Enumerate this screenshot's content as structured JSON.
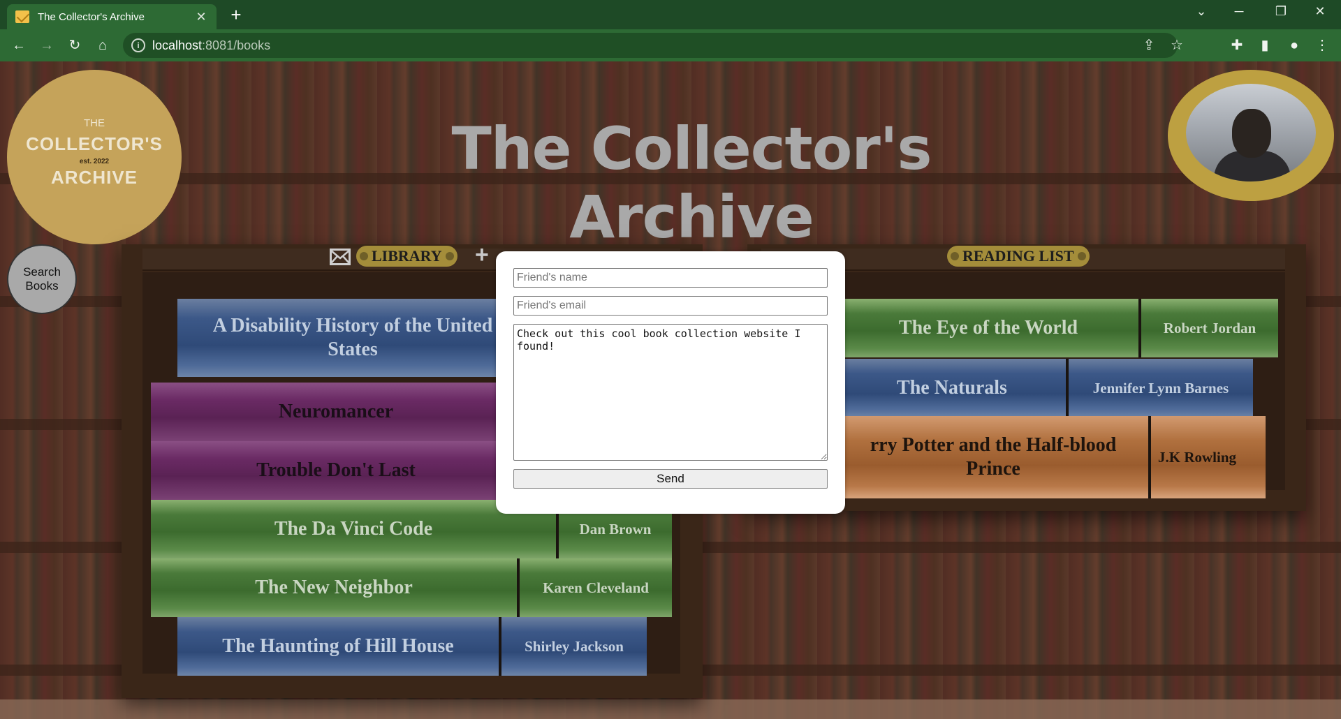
{
  "browser": {
    "tab_title": "The Collector's Archive",
    "tab_close": "✕",
    "new_tab": "+",
    "url_host": "localhost",
    "url_rest": ":8081/books",
    "info_glyph": "i",
    "icons": [
      "back-icon",
      "forward-icon",
      "reload-icon",
      "home-icon",
      "share-icon",
      "star-icon",
      "extensions-icon",
      "sidepanel-icon",
      "profile-icon",
      "menu-icon"
    ]
  },
  "site": {
    "logo": {
      "line1": "THE",
      "line2": "COLLECTOR'S",
      "line3": "est. 2022",
      "line4": "ARCHIVE"
    },
    "title": "The Collector's Archive",
    "search_books_label": "Search Books"
  },
  "library": {
    "label": "LIBRARY",
    "books": [
      {
        "title": "A Disability History of the United States",
        "author": "",
        "color": "blue"
      },
      {
        "title": "Neuromancer",
        "author": "",
        "color": "purple"
      },
      {
        "title": "Trouble Don't Last",
        "author": "",
        "color": "purple"
      },
      {
        "title": "The Da Vinci Code",
        "author": "Dan Brown",
        "color": "green"
      },
      {
        "title": "The New Neighbor",
        "author": "Karen Cleveland",
        "color": "green"
      },
      {
        "title": "The Haunting of Hill House",
        "author": "Shirley Jackson",
        "color": "blue"
      }
    ]
  },
  "reading_list": {
    "label": "READING LIST",
    "books": [
      {
        "title": "The Eye of the World",
        "author": "Robert Jordan",
        "color": "green"
      },
      {
        "title": "The Naturals",
        "author": "Jennifer Lynn Barnes",
        "color": "blue"
      },
      {
        "title": "rry Potter and the Half-blood Prince",
        "author": "J.K Rowling",
        "color": "orange"
      }
    ]
  },
  "share_modal": {
    "name_placeholder": "Friend's name",
    "email_placeholder": "Friend's email",
    "message": "Check out this cool book collection website I found!",
    "send_label": "Send"
  },
  "colors": {
    "chrome_dark": "#1e4a26",
    "chrome": "#2d6a34",
    "gold": "#c5a35a",
    "pill": "#a48d3a"
  }
}
